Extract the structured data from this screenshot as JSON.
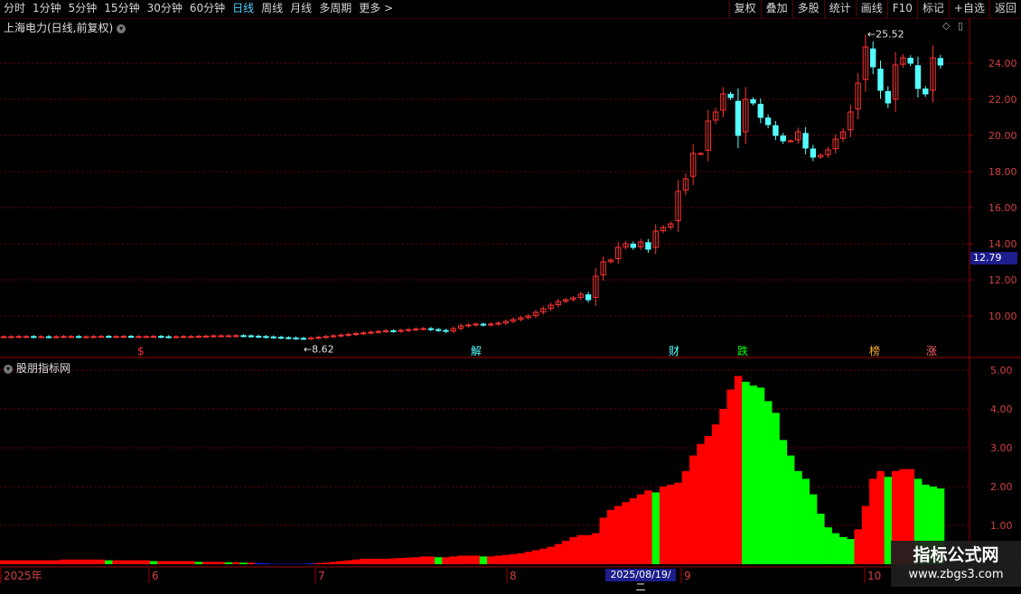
{
  "toolbar": {
    "periods": [
      "分时",
      "1分钟",
      "5分钟",
      "15分钟",
      "30分钟",
      "60分钟",
      "日线",
      "周线",
      "月线",
      "多周期",
      "更多 >"
    ],
    "active_period": "日线",
    "actions": [
      "复权",
      "叠加",
      "多股",
      "统计",
      "画线",
      "F10",
      "标记",
      "+自选",
      "返回"
    ]
  },
  "main_chart": {
    "title": "上海电力(日线,前复权)",
    "y_ticks": [
      "24.00",
      "22.00",
      "20.00",
      "18.00",
      "16.00",
      "14.00",
      "12.00",
      "10.00"
    ],
    "current_price": "12.79",
    "high_label": "25.52",
    "low_label": "8.62",
    "markers": [
      "$",
      "解",
      "财",
      "跌",
      "榜",
      "涨"
    ]
  },
  "sub_chart": {
    "title": "股朋指标网",
    "y_ticks": [
      "5.00",
      "4.00",
      "3.00",
      "2.00",
      "1.00"
    ]
  },
  "x_axis": {
    "labels": [
      "2025年",
      "6",
      "7",
      "8",
      "9",
      "10"
    ],
    "cursor_date": "2025/08/19/二"
  },
  "watermark": {
    "line1": "指标公式网",
    "line2": "www.zbgs3.com"
  },
  "colors": {
    "up": "#ff3232",
    "down": "#54ffff",
    "grid": "#7a0000",
    "bar_up": "#ff0000",
    "bar_down": "#00ff00",
    "bar_low": "#2020ff"
  },
  "chart_data": [
    {
      "type": "candlestick",
      "title": "上海电力(日线,前复权)",
      "ylim": [
        8.4,
        26.0
      ],
      "max_price": 25.52,
      "min_price": 8.62,
      "closes": [
        8.85,
        8.85,
        8.86,
        8.86,
        8.85,
        8.85,
        8.84,
        8.85,
        8.86,
        8.86,
        8.85,
        8.85,
        8.86,
        8.87,
        8.86,
        8.86,
        8.87,
        8.86,
        8.86,
        8.86,
        8.87,
        8.85,
        8.84,
        8.85,
        8.86,
        8.86,
        8.87,
        8.88,
        8.9,
        8.9,
        8.9,
        8.91,
        8.9,
        8.88,
        8.86,
        8.84,
        8.82,
        8.8,
        8.78,
        8.76,
        8.75,
        8.78,
        8.82,
        8.86,
        8.9,
        8.94,
        8.98,
        9.02,
        9.06,
        9.1,
        9.14,
        9.18,
        9.16,
        9.2,
        9.24,
        9.28,
        9.3,
        9.25,
        9.2,
        9.15,
        9.3,
        9.45,
        9.5,
        9.55,
        9.5,
        9.55,
        9.6,
        9.7,
        9.8,
        9.9,
        10.0,
        10.2,
        10.4,
        10.6,
        10.8,
        10.9,
        11.0,
        11.2,
        10.9,
        12.2,
        13.0,
        13.1,
        13.8,
        14.0,
        13.8,
        14.1,
        13.7,
        14.7,
        14.9,
        15.1,
        16.9,
        17.6,
        19.0,
        19.0,
        20.8,
        21.3,
        22.3,
        22.1,
        20.0,
        22.0,
        21.8,
        21.0,
        20.6,
        20.0,
        19.7,
        19.7,
        20.2,
        19.3,
        18.8,
        18.9,
        19.2,
        19.8,
        20.2,
        21.3,
        22.9,
        24.9,
        23.8,
        22.5,
        21.8,
        23.9,
        24.3,
        24.0,
        22.6,
        22.3,
        24.3,
        23.9
      ],
      "series": [
        {
          "values": []
        }
      ]
    },
    {
      "type": "bar",
      "title": "股朋指标网",
      "ylim": [
        0,
        5.0
      ],
      "values": [
        0.1,
        0.1,
        0.1,
        0.1,
        0.1,
        0.1,
        0.1,
        0.1,
        0.12,
        0.12,
        0.12,
        0.12,
        0.12,
        0.12,
        0.1,
        0.1,
        0.1,
        0.1,
        0.1,
        0.1,
        0.08,
        0.08,
        0.08,
        0.08,
        0.08,
        0.08,
        0.06,
        0.06,
        0.06,
        0.06,
        0.05,
        0.05,
        0.04,
        0.04,
        0.03,
        0.02,
        0.01,
        0.01,
        0.01,
        0.01,
        0.01,
        0.02,
        0.03,
        0.04,
        0.06,
        0.08,
        0.1,
        0.12,
        0.14,
        0.14,
        0.14,
        0.14,
        0.15,
        0.16,
        0.17,
        0.18,
        0.2,
        0.2,
        0.18,
        0.18,
        0.2,
        0.22,
        0.22,
        0.22,
        0.2,
        0.2,
        0.22,
        0.24,
        0.26,
        0.28,
        0.32,
        0.36,
        0.4,
        0.45,
        0.52,
        0.6,
        0.7,
        0.75,
        0.75,
        0.8,
        1.2,
        1.4,
        1.5,
        1.6,
        1.7,
        1.8,
        1.9,
        1.85,
        2.0,
        2.05,
        2.1,
        2.4,
        2.8,
        3.1,
        3.3,
        3.6,
        4.0,
        4.5,
        4.85,
        4.7,
        4.6,
        4.55,
        4.2,
        3.9,
        3.2,
        2.8,
        2.4,
        2.2,
        1.8,
        1.3,
        0.95,
        0.8,
        0.7,
        0.65,
        0.9,
        1.5,
        2.2,
        2.4,
        2.25,
        2.4,
        2.45,
        2.45,
        2.2,
        2.05,
        2.0,
        1.95
      ],
      "colors_by_index": "red when rising, green when falling"
    }
  ]
}
